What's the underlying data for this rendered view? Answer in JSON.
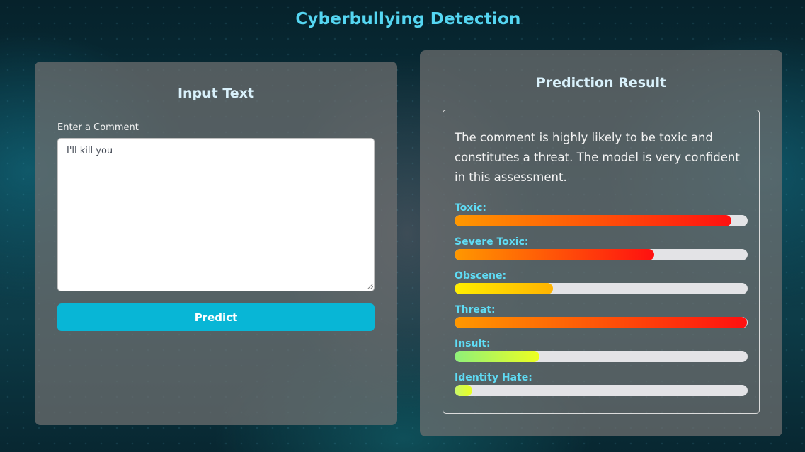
{
  "page": {
    "title": "Cyberbullying Detection"
  },
  "input_panel": {
    "heading": "Input Text",
    "field_label": "Enter a Comment",
    "comment_value": "I'll kill you",
    "predict_label": "Predict"
  },
  "result_panel": {
    "heading": "Prediction Result",
    "summary": "The comment is highly likely to be toxic and constitutes a threat. The model is very confident in this assessment.",
    "metrics": [
      {
        "label": "Toxic:",
        "value": 0.945,
        "gradient_start": "#ff9800",
        "gradient_end": "#ff1010"
      },
      {
        "label": "Severe Toxic:",
        "value": 0.68,
        "gradient_start": "#ff9800",
        "gradient_end": "#ff1010"
      },
      {
        "label": "Obscene:",
        "value": 0.335,
        "gradient_start": "#ffee00",
        "gradient_end": "#ffb300"
      },
      {
        "label": "Threat:",
        "value": 0.998,
        "gradient_start": "#ff9800",
        "gradient_end": "#ff1010"
      },
      {
        "label": "Insult:",
        "value": 0.29,
        "gradient_start": "#8ef07a",
        "gradient_end": "#eeff20"
      },
      {
        "label": "Identity Hate:",
        "value": 0.06,
        "gradient_start": "#c8f76a",
        "gradient_end": "#eaff20"
      }
    ]
  }
}
